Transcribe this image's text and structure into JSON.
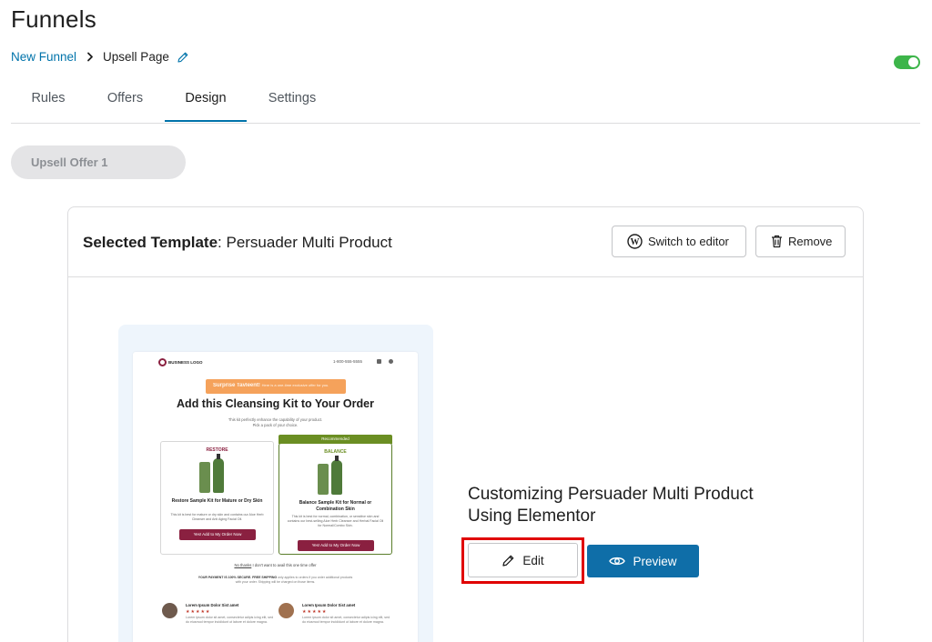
{
  "page": {
    "title": "Funnels"
  },
  "breadcrumb": {
    "parent": "New Funnel",
    "current": "Upsell Page"
  },
  "toggle": {
    "state": "on",
    "color": "#3db54a"
  },
  "tabs": [
    {
      "label": "Rules",
      "active": false
    },
    {
      "label": "Offers",
      "active": false
    },
    {
      "label": "Design",
      "active": true
    },
    {
      "label": "Settings",
      "active": false
    }
  ],
  "offer_pill": {
    "label": "Upsell Offer 1"
  },
  "template_card": {
    "selected_label": "Selected Template",
    "selected_name": ": Persuader Multi Product",
    "switch_button": "Switch to editor",
    "remove_button": "Remove",
    "customize_prefix": "Customizing ",
    "customize_template": "Persuader Multi Product",
    "customize_using": "Using ",
    "customize_builder": "Elementor",
    "edit_button": "Edit",
    "preview_button": "Preview"
  },
  "thumbnail": {
    "logo": "BUSINESS LOGO",
    "phone": "1-800-555-5555",
    "banner_title": "Surprise Tavleent!",
    "banner_sub": "Here is a one-time exclusive offer for you.",
    "headline": "Add this Cleansing Kit to Your Order",
    "subline_1": "This kit perfectly enhance the capability of your product.",
    "subline_2": "Pick a pack of your choice.",
    "recommended": "Recommended",
    "left_box": {
      "tag": "RESTORE",
      "name": "Restore Sample Kit for Mature or Dry Skin",
      "desc": "This kit is best for mature or dry skin and contains our Aloe Herb Cleanser and Anti Aging Facial Oil.",
      "button": "Yes! Add to My Order Now"
    },
    "right_box": {
      "tag": "BALANCE",
      "name": "Balance Sample Kit for Normal or Combination Skin",
      "desc": "This kit is best for normal, combination, or sensitive skin and contains our best-selling Aloe Herb Cleanser and Herbal Facial Oil for Normal/Combo Skin.",
      "button": "Yes! Add to My Order Now"
    },
    "no_thanks_link": "No thanks",
    "no_thanks_text": " I don't want to avail this one time offer",
    "fine_bold": "YOUR PAYMENT IS 100% SECURE. FREE SHIPPING",
    "fine_text": " only applies to orders if you order additional products with your order. Shipping will be charged on those items.",
    "reviews": [
      {
        "name": "Lorem Ipsum Dolor Sist amet",
        "stars": "★★★★★",
        "text": "Lorem ipsum dolor sit amet, consectetur adipis icing elit, sed do eiusmod tempor incididunt ut labore et dolore magna."
      },
      {
        "name": "Lorem Ipsum Dolor Sist amet",
        "stars": "★★★★★",
        "text": "Lorem ipsum dolor sit amet, consectetur adipis icing elit, sed do eiusmod tempor incididunt ut labore et dolore magna."
      }
    ]
  },
  "colors": {
    "link": "#0073aa",
    "primary_button": "#0f6ea8",
    "highlight": "#e00000",
    "thumb_bg": "#eef5fc"
  },
  "icons": [
    "chevron-right-icon",
    "pencil-icon",
    "wordpress-icon",
    "trash-icon",
    "eye-icon"
  ]
}
